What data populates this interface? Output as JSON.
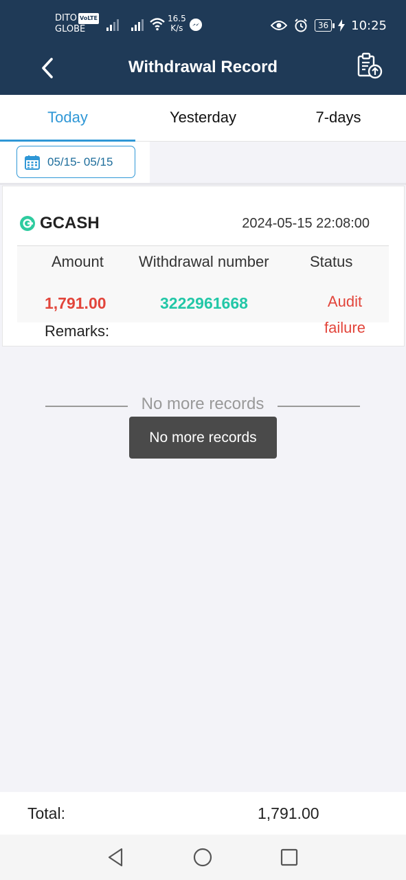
{
  "status_bar": {
    "carrier_line1": "DITO",
    "volte": "VoLTE",
    "carrier_line2": "GLOBE",
    "net_speed_value": "16.5",
    "net_speed_unit": "K/s",
    "battery": "36",
    "time": "10:25"
  },
  "header": {
    "title": "Withdrawal Record"
  },
  "tabs": [
    {
      "label": "Today",
      "active": true
    },
    {
      "label": "Yesterday",
      "active": false
    },
    {
      "label": "7-days",
      "active": false
    }
  ],
  "filter": {
    "date_range": "05/15- 05/15"
  },
  "record": {
    "method": "GCASH",
    "datetime": "2024-05-15 22:08:00",
    "headers": {
      "amount": "Amount",
      "number": "Withdrawal number",
      "status": "Status"
    },
    "amount": "1,791.00",
    "number": "3222961668",
    "status": "Audit failure",
    "remarks_label": "Remarks:"
  },
  "list_end": {
    "label": "No more records"
  },
  "toast": {
    "message": "No more records"
  },
  "footer": {
    "total_label": "Total:",
    "total_value": "1,791.00"
  },
  "colors": {
    "header_bg": "#1f3a57",
    "accent": "#2f97d6",
    "amount": "#e2453b",
    "number": "#22c7a7",
    "status": "#e2453b"
  }
}
